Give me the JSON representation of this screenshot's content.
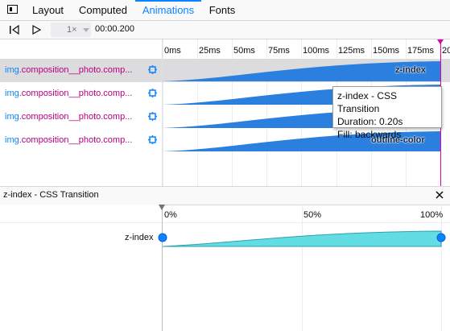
{
  "tabs": [
    {
      "label": "Layout"
    },
    {
      "label": "Computed"
    },
    {
      "label": "Animations"
    },
    {
      "label": "Fonts"
    }
  ],
  "toolbar": {
    "rate": "1×",
    "current_time": "00:00.200"
  },
  "timeline": {
    "ticks": [
      "0ms",
      "25ms",
      "50ms",
      "75ms",
      "100ms",
      "125ms",
      "150ms",
      "175ms"
    ],
    "end_tick": "20",
    "rows": [
      {
        "element": "img",
        "class": ".composition__photo.comp...",
        "property_label": "z-index",
        "selected": true
      },
      {
        "element": "img",
        "class": ".composition__photo.comp...",
        "property_label": "",
        "selected": false
      },
      {
        "element": "img",
        "class": ".composition__photo.comp...",
        "property_label": "",
        "selected": false
      },
      {
        "element": "img",
        "class": ".composition__photo.comp...",
        "property_label": "outline-color",
        "selected": false
      }
    ]
  },
  "tooltip": {
    "line1": "z-index - CSS Transition",
    "line2": "Duration: 0.20s",
    "line3": "Fill: backwards"
  },
  "detail": {
    "title": "z-index - CSS Transition",
    "percent_labels": [
      "0%",
      "50%",
      "100%"
    ],
    "property": "z-index"
  },
  "colors": {
    "accent": "#0a84ff",
    "playhead": "#dd00a9",
    "animation_fill": "#2a7fdf",
    "keyframe_fill": "#62dde3"
  }
}
